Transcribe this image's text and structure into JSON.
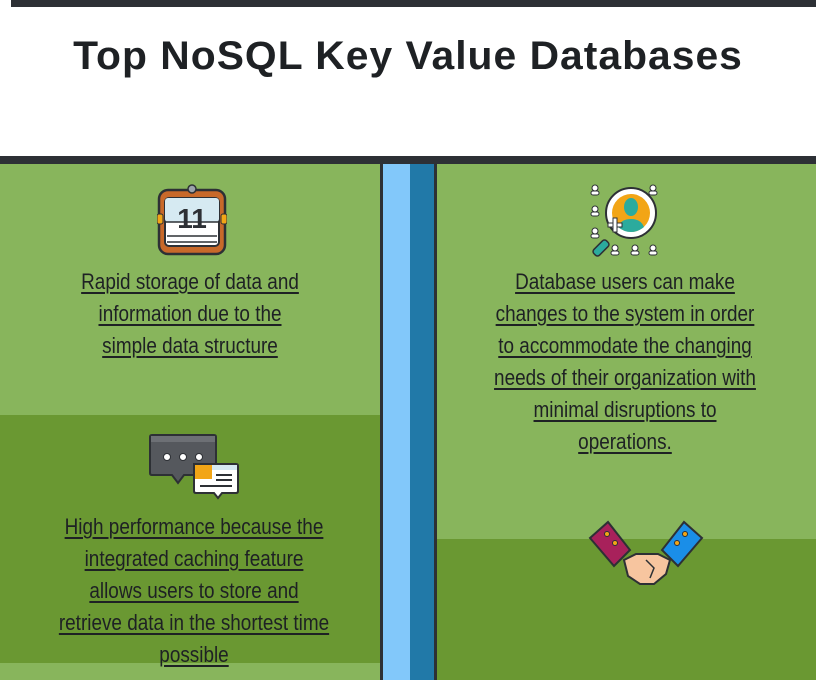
{
  "header": {
    "title": "Top NoSQL Key Value Databases"
  },
  "features": [
    {
      "icon": "calendar-icon",
      "icon_number": "11",
      "text": "Rapid storage of data and \ninformation due to the \nsimple data structure"
    },
    {
      "icon": "chat-bubbles-icon",
      "text": "High performance because the \nintegrated caching feature \nallows users to store and \nretrieve data in the shortest time \npossible"
    },
    {
      "icon": "user-search-icon",
      "text": "Database users can make \nchanges to the system in order \nto accommodate the changing \nneeds of their organization with \nminimal disruptions to \noperations."
    },
    {
      "icon": "handshake-icon"
    }
  ],
  "colors": {
    "light_green": "#88b55c",
    "dark_green": "#6a9832",
    "divider_light_blue": "#82c8fa",
    "divider_dark_blue": "#2179a8",
    "bar_dark": "#2d3035"
  }
}
